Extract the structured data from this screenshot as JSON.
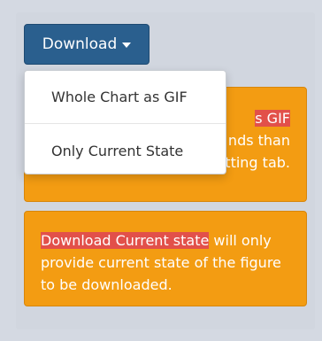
{
  "download_button": {
    "label": "Download",
    "caret_icon": "caret-down-icon"
  },
  "dropdown": {
    "items": [
      {
        "label": "Whole Chart as GIF"
      },
      {
        "label": "Only Current State"
      }
    ]
  },
  "cards": [
    {
      "visible_fragments": {
        "line1_highlight": "s GIF",
        "line2": "nds than",
        "line3": "the time assigned in setting tab."
      }
    },
    {
      "highlight": "Download Current state",
      "rest": " will only provide current state of the figure to be downloaded."
    }
  ],
  "colors": {
    "button_bg": "#2a5f8e",
    "card_bg": "#f39c12",
    "highlight_bg": "#e2504a",
    "page_bg": "#d4d9e2"
  }
}
